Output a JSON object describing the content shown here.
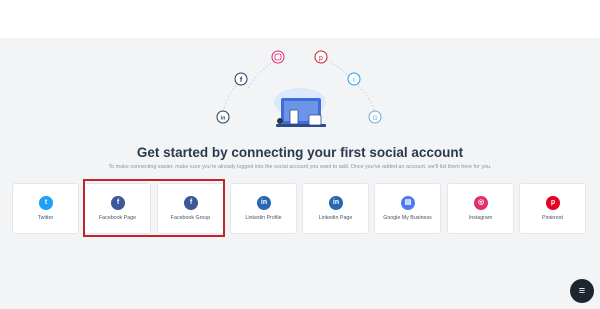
{
  "heading": {
    "title": "Get started by connecting your first social account",
    "subtitle": "To make connecting easier, make sure you're already logged into the social account you want to add. Once you've added an account, we'll list them here for you."
  },
  "hero_icons": [
    {
      "name": "instagram-icon",
      "color": "#d6246e"
    },
    {
      "name": "pinterest-icon",
      "color": "#c8232c"
    },
    {
      "name": "facebook-icon",
      "color": "#1e3a5f"
    },
    {
      "name": "twitter-icon",
      "color": "#1da1f2"
    },
    {
      "name": "linkedin-icon",
      "color": "#1e3a5f"
    },
    {
      "name": "google-icon",
      "color": "#6fa8dc"
    }
  ],
  "accounts": [
    {
      "label": "Twitter",
      "icon": "twitter-icon",
      "glyph": "t",
      "color": "#1da1f2"
    },
    {
      "label": "Facebook Page",
      "icon": "facebook-icon",
      "glyph": "f",
      "color": "#3b5998"
    },
    {
      "label": "Facebook Group",
      "icon": "facebook-icon",
      "glyph": "f",
      "color": "#3b5998"
    },
    {
      "label": "Linkedin Profile",
      "icon": "linkedin-icon",
      "glyph": "in",
      "color": "#2867b2"
    },
    {
      "label": "Linkedin Page",
      "icon": "linkedin-icon",
      "glyph": "in",
      "color": "#2867b2"
    },
    {
      "label": "Google My Business",
      "icon": "google-my-business-icon",
      "glyph": "▤",
      "color": "#4c7cf0"
    },
    {
      "label": "Instagram",
      "icon": "instagram-icon",
      "glyph": "◎",
      "color": "#e1306c"
    },
    {
      "label": "Pinterest",
      "icon": "pinterest-icon",
      "glyph": "p",
      "color": "#e60023"
    }
  ],
  "fab": {
    "icon": "menu-icon",
    "glyph": "≡"
  }
}
